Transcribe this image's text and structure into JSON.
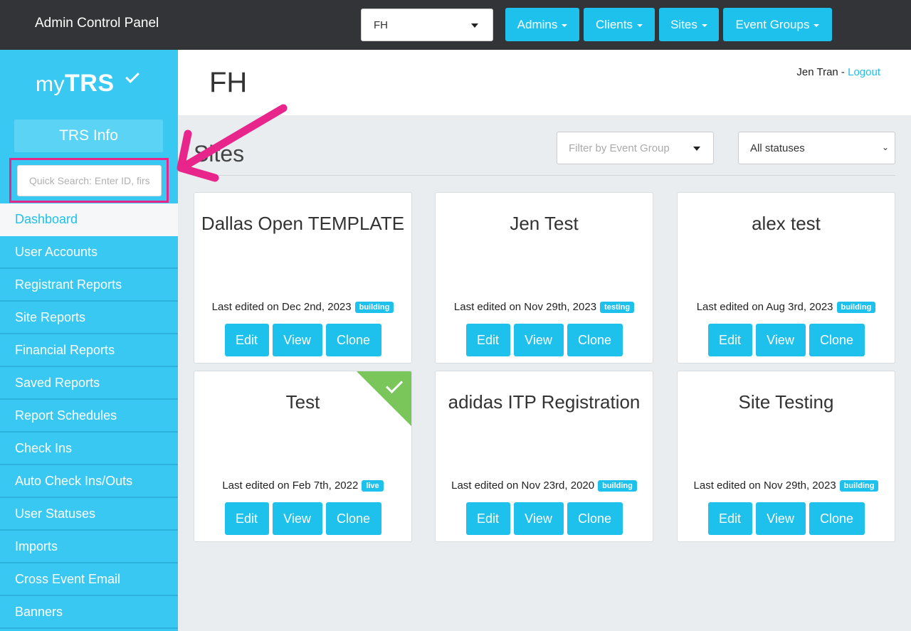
{
  "topbar": {
    "title": "Admin Control Panel",
    "client_select": "FH",
    "menus": [
      {
        "label": "Admins"
      },
      {
        "label": "Clients"
      },
      {
        "label": "Sites"
      },
      {
        "label": "Event Groups"
      }
    ]
  },
  "sidebar": {
    "logo_my": "my",
    "logo_trs": "TRS",
    "info_button": "TRS Info",
    "search_placeholder": "Quick Search: Enter ID, first",
    "items": [
      {
        "label": "Dashboard"
      },
      {
        "label": "User Accounts"
      },
      {
        "label": "Registrant Reports"
      },
      {
        "label": "Site Reports"
      },
      {
        "label": "Financial Reports"
      },
      {
        "label": "Saved Reports"
      },
      {
        "label": "Report Schedules"
      },
      {
        "label": "Check Ins"
      },
      {
        "label": "Auto Check Ins/Outs"
      },
      {
        "label": "User Statuses"
      },
      {
        "label": "Imports"
      },
      {
        "label": "Cross Event Email"
      },
      {
        "label": "Banners"
      }
    ]
  },
  "header": {
    "title": "FH",
    "user_name": "Jen Tran",
    "separator": " - ",
    "logout": "Logout"
  },
  "sites": {
    "title": "Sites",
    "filter_event_group": "Filter by Event Group",
    "status_select": "All statuses",
    "cards": [
      {
        "title": "Dallas Open TEMPLATE",
        "meta": "Last edited on Dec 2nd, 2023",
        "status": "building"
      },
      {
        "title": "Jen Test",
        "meta": "Last edited on Nov 29th, 2023",
        "status": "testing"
      },
      {
        "title": "alex test",
        "meta": "Last edited on Aug 3rd, 2023",
        "status": "building"
      },
      {
        "title": "Test",
        "meta": "Last edited on Feb 7th, 2022",
        "status": "live"
      },
      {
        "title": "adidas ITP Registration",
        "meta": "Last edited on Nov 23rd, 2020",
        "status": "building"
      },
      {
        "title": "Site Testing",
        "meta": "Last edited on Nov 29th, 2023",
        "status": "building"
      }
    ],
    "buttons": {
      "edit": "Edit",
      "view": "View",
      "clone": "Clone"
    }
  },
  "colors": {
    "accent": "#1ec1ec",
    "sidebar": "#39c8f1",
    "topbar": "#333437",
    "live": "#7ac65b",
    "annotation": "#e8258b"
  }
}
